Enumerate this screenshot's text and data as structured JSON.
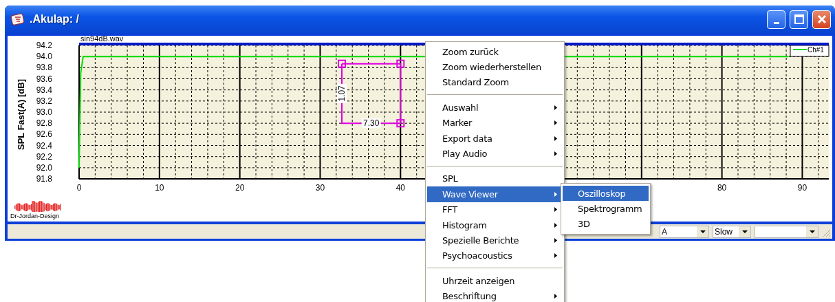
{
  "window": {
    "title": ".Akulap: /"
  },
  "chart_panel": {
    "logo_text": "Dr-Jordan-Design",
    "chart_data": {
      "type": "line",
      "title": "sin94dB.wav",
      "ylabel": "SPL Fast(A) [dB]",
      "x": [
        0,
        0.2,
        0.5,
        1,
        5,
        10,
        20,
        30,
        40,
        62,
        70,
        80,
        88.3
      ],
      "series": [
        {
          "name": "Ch#1",
          "color": "#00dd00",
          "values": [
            92.0,
            93.7,
            94.0,
            94.0,
            94.0,
            94.0,
            94.0,
            94.0,
            94.0,
            94.0,
            94.0,
            94.0,
            94.0
          ]
        }
      ],
      "grid": true,
      "xlim": [
        0,
        93.3
      ],
      "ylim": [
        91.8,
        94.2
      ],
      "xticks": [
        0,
        10,
        20,
        30,
        40,
        80,
        90
      ],
      "yticks": [
        {
          "value": 94.2,
          "label": "94.2"
        },
        {
          "value": 94.0,
          "label": "94.0"
        },
        {
          "value": 93.8,
          "label": "93.8"
        },
        {
          "value": 93.6,
          "label": "93.6"
        },
        {
          "value": 93.4,
          "label": "93.4"
        },
        {
          "value": 93.2,
          "label": "93.2"
        },
        {
          "value": 93.0,
          "label": "93.0"
        },
        {
          "value": 92.8,
          "label": "92.8"
        },
        {
          "value": 92.6,
          "label": "92.6"
        },
        {
          "value": 92.4,
          "label": "92.4"
        },
        {
          "value": 92.2,
          "label": "92.2"
        },
        {
          "value": 92.0,
          "label": "92.0"
        },
        {
          "value": 91.8,
          "label": "91.8"
        }
      ],
      "annotations": [
        "1.07",
        "7.30"
      ]
    }
  },
  "status_bar": {
    "dropdowns": [
      {
        "kind": "value",
        "value": "A"
      },
      {
        "kind": "value",
        "value": "Slow"
      },
      {
        "kind": "blank"
      }
    ]
  },
  "context_menu": {
    "items": [
      {
        "kind": "item",
        "label": "Zoom zurück",
        "submenu": false,
        "selected": false
      },
      {
        "kind": "item",
        "label": "Zoom wiederherstellen",
        "submenu": false,
        "selected": false
      },
      {
        "kind": "item",
        "label": "Standard Zoom",
        "submenu": false,
        "selected": false
      },
      {
        "kind": "separator"
      },
      {
        "kind": "item",
        "label": "Auswahl",
        "submenu": true,
        "selected": false
      },
      {
        "kind": "item",
        "label": "Marker",
        "submenu": true,
        "selected": false
      },
      {
        "kind": "item",
        "label": "Export data",
        "submenu": true,
        "selected": false
      },
      {
        "kind": "item",
        "label": "Play Audio",
        "submenu": true,
        "selected": false
      },
      {
        "kind": "separator"
      },
      {
        "kind": "item",
        "label": "SPL",
        "submenu": false,
        "selected": false
      },
      {
        "kind": "item",
        "label": "Wave Viewer",
        "submenu": true,
        "selected": true
      },
      {
        "kind": "item",
        "label": "FFT",
        "submenu": true,
        "selected": false
      },
      {
        "kind": "item",
        "label": "Histogram",
        "submenu": true,
        "selected": false
      },
      {
        "kind": "item",
        "label": "Spezielle Berichte",
        "submenu": true,
        "selected": false
      },
      {
        "kind": "item",
        "label": "Psychoacoustics",
        "submenu": true,
        "selected": false
      },
      {
        "kind": "separator"
      },
      {
        "kind": "item",
        "label": "Uhrzeit anzeigen",
        "submenu": false,
        "selected": false
      },
      {
        "kind": "item",
        "label": "Beschriftung",
        "submenu": true,
        "selected": false
      }
    ]
  },
  "submenu": {
    "items": [
      {
        "label": "Oszilloskop",
        "selected": true
      },
      {
        "label": "Spektrogramm",
        "selected": false
      },
      {
        "label": "3D",
        "selected": false
      }
    ]
  }
}
